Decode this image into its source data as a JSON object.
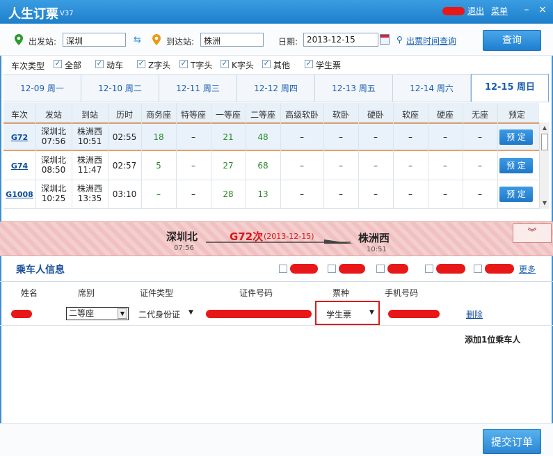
{
  "window": {
    "title": "人生订票",
    "version": "V37",
    "logout": "退出",
    "menu": "菜单",
    "minimize": "–",
    "close": "×"
  },
  "search": {
    "from_label": "出发站:",
    "from_value": "深圳",
    "to_label": "到达站:",
    "to_value": "株洲",
    "date_label": "日期:",
    "date_value": "2013-12-15",
    "time_link": "出票时间查询",
    "query_button": "查询"
  },
  "filters": {
    "label": "车次类型",
    "items": [
      {
        "label": "全部",
        "checked": true
      },
      {
        "label": "动车",
        "checked": true
      },
      {
        "label": "Z字头",
        "checked": true
      },
      {
        "label": "T字头",
        "checked": true
      },
      {
        "label": "K字头",
        "checked": true
      },
      {
        "label": "其他",
        "checked": true
      },
      {
        "label": "学生票",
        "checked": true
      }
    ]
  },
  "date_tabs": [
    "12-09 周一",
    "12-10 周二",
    "12-11 周三",
    "12-12 周四",
    "12-13 周五",
    "12-14 周六",
    "12-15 周日"
  ],
  "table": {
    "headers": [
      "车次",
      "发站",
      "到站",
      "历时",
      "商务座",
      "特等座",
      "一等座",
      "二等座",
      "高级软卧",
      "软卧",
      "硬卧",
      "软座",
      "硬座",
      "无座",
      "预定"
    ],
    "rows": [
      {
        "train": "G72",
        "from": "深圳北",
        "from_time": "07:56",
        "to": "株洲西",
        "to_time": "10:51",
        "duration": "02:55",
        "business": "18",
        "special": "–",
        "first": "21",
        "second": "48",
        "hsoft": "–",
        "soft": "–",
        "hard": "–",
        "softseat": "–",
        "hardseat": "–",
        "noseat": "–",
        "book": "预 定"
      },
      {
        "train": "G74",
        "from": "深圳北",
        "from_time": "08:50",
        "to": "株洲西",
        "to_time": "11:47",
        "duration": "02:57",
        "business": "5",
        "special": "–",
        "first": "27",
        "second": "68",
        "hsoft": "–",
        "soft": "–",
        "hard": "–",
        "softseat": "–",
        "hardseat": "–",
        "noseat": "–",
        "book": "预 定"
      },
      {
        "train": "G1008",
        "from": "深圳北",
        "from_time": "10:25",
        "to": "株洲西",
        "to_time": "13:35",
        "duration": "03:10",
        "business": "–",
        "special": "–",
        "first": "28",
        "second": "13",
        "hsoft": "–",
        "soft": "–",
        "hard": "–",
        "softseat": "–",
        "hardseat": "–",
        "noseat": "–",
        "book": "预 定"
      }
    ]
  },
  "journey": {
    "from": "深圳北",
    "from_time": "07:56",
    "train": "G72次",
    "date": "(2013-12-15)",
    "to": "株洲西",
    "to_time": "10:51",
    "collapse": "︾"
  },
  "passenger": {
    "title": "乘车人信息",
    "more": "更多",
    "headers": [
      "姓名",
      "席别",
      "证件类型",
      "证件号码",
      "票种",
      "手机号码"
    ],
    "seat": "二等座",
    "id_type": "二代身份证",
    "ticket_type": "学生票",
    "delete": "删除",
    "add": "添加1位乘车人"
  },
  "submit": "提交订单",
  "colors": {
    "accent": "#1e7fd0",
    "highlight": "#d91c1c"
  }
}
